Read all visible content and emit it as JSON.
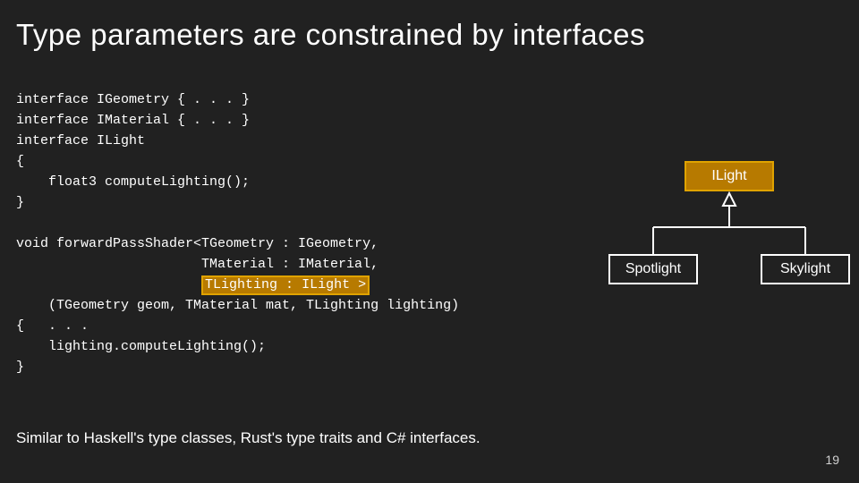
{
  "title": "Type parameters are constrained by interfaces",
  "code": {
    "l1": "interface IGeometry { . . . }",
    "l2": "interface IMaterial { . . . }",
    "l3": "interface ILight",
    "l4": "{",
    "l5": "    float3 computeLighting();",
    "l6": "}",
    "l7": "",
    "l8a": "void forwardPassShader<TGeometry : IGeometry,",
    "l9": "                       TMaterial : IMaterial,",
    "l10pre": "                       ",
    "l10hl": "TLighting : ILight >",
    "l11": "    (TGeometry geom, TMaterial mat, TLighting lighting)",
    "l12": "{   . . .",
    "l13": "    lighting.computeLighting();",
    "l14": "}"
  },
  "diagram": {
    "root": "ILight",
    "left": "Spotlight",
    "right": "Skylight"
  },
  "footnote": "Similar to Haskell's type classes, Rust's type traits and C# interfaces.",
  "pagenum": "19"
}
